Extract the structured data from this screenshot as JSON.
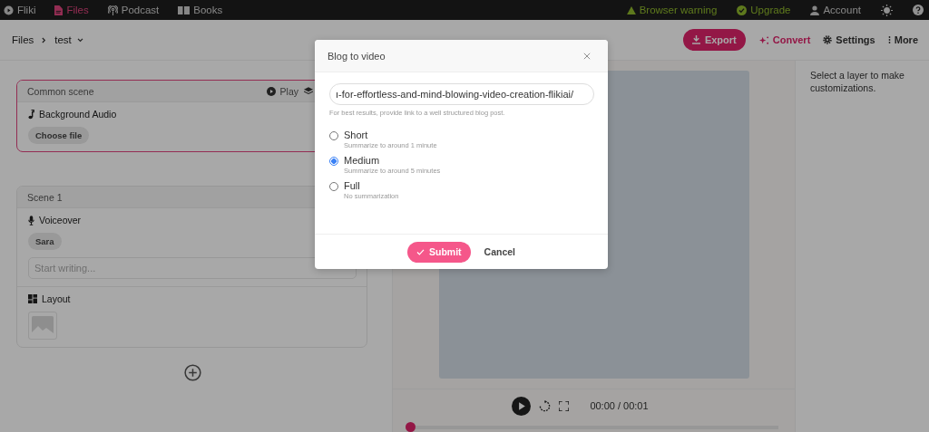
{
  "nav": [
    {
      "label": "Fliki",
      "kind": "logo",
      "selected": false
    },
    {
      "label": "Files",
      "kind": "file",
      "selected": true
    },
    {
      "label": "Podcast",
      "kind": "podcast",
      "selected": false
    },
    {
      "label": "Books",
      "kind": "book",
      "selected": false
    }
  ],
  "status": [
    {
      "label": "Browser warning",
      "kind": "warning"
    },
    {
      "label": "Upgrade",
      "kind": "upgrade"
    },
    {
      "label": "Account",
      "kind": "account"
    }
  ],
  "breadcrumb": {
    "root": "Files",
    "current": "test"
  },
  "actions": [
    {
      "label": "Export",
      "kind": "export"
    },
    {
      "label": "Convert",
      "kind": "convert"
    },
    {
      "label": "Settings",
      "kind": "settings"
    },
    {
      "label": "More",
      "kind": "more"
    }
  ],
  "common_scene": {
    "title": "Common scene",
    "play": "Play",
    "audio_label": "Background Audio",
    "choose": "Choose file"
  },
  "scene": {
    "title": "Scene 1",
    "voiceover": "Voiceover",
    "voice": "Sara",
    "placeholder": "Start writing...",
    "layout": "Layout"
  },
  "player": {
    "time": "00:00 / 00:01",
    "level": 0
  },
  "inspector": {
    "hint": "Select a layer to make customizations."
  },
  "modal": {
    "title": "Blog to video",
    "url": "ı-for-effortless-and-mind-blowing-video-creation-flikiai/",
    "hint": "For best results, provide link to a well structured blog post.",
    "options": [
      {
        "label": "Short",
        "desc": "Summarize to around 1 minute",
        "selected": false
      },
      {
        "label": "Medium",
        "desc": "Summarize to around 5 minutes",
        "selected": true
      },
      {
        "label": "Full",
        "desc": "No summarization",
        "selected": false
      }
    ],
    "submit": "Submit",
    "cancel": "Cancel"
  }
}
